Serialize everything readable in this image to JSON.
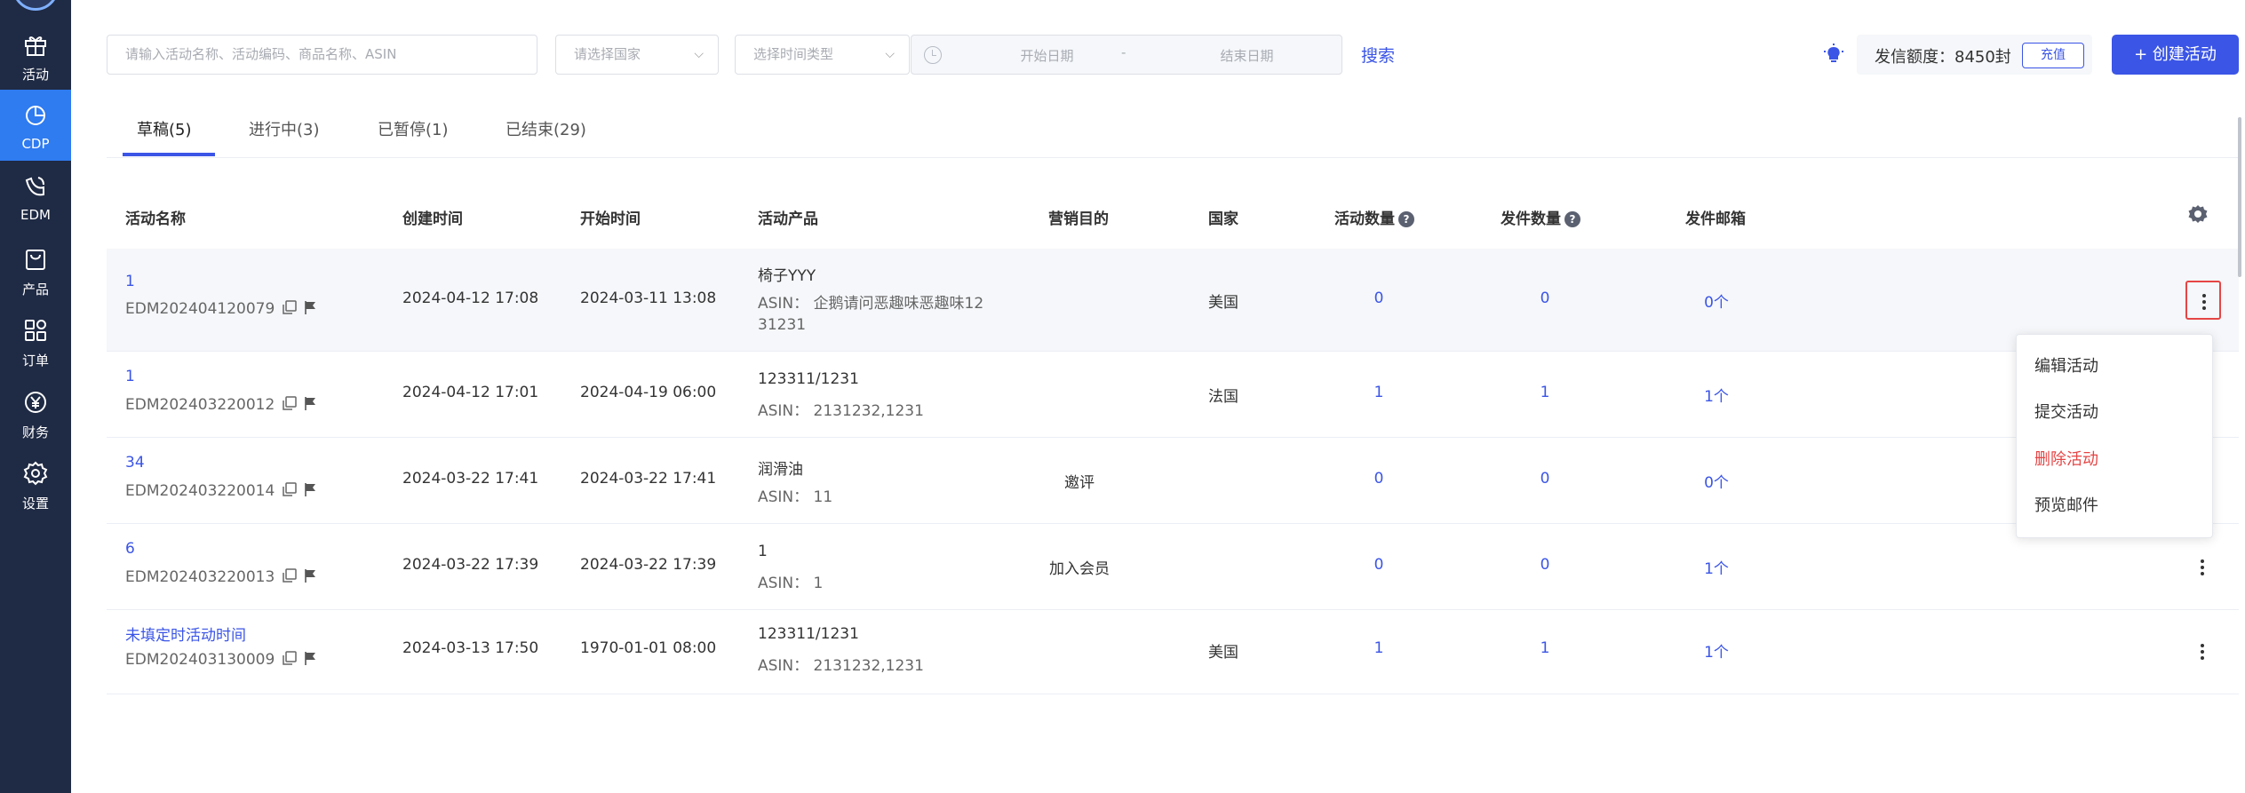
{
  "sidebar": {
    "items": [
      {
        "label": "活动",
        "icon": "gift-icon",
        "active": false
      },
      {
        "label": "CDP",
        "icon": "pie-chart-icon",
        "active": true
      },
      {
        "label": "EDM",
        "icon": "edm-icon",
        "active": false
      },
      {
        "label": "产品",
        "icon": "product-bag-icon",
        "active": false
      },
      {
        "label": "订单",
        "icon": "order-grid-icon",
        "active": false
      },
      {
        "label": "财务",
        "icon": "finance-yen-icon",
        "active": false
      },
      {
        "label": "设置",
        "icon": "settings-gear-icon",
        "active": false
      }
    ]
  },
  "toolbar": {
    "search_placeholder": "请输入活动名称、活动编码、商品名称、ASIN",
    "country_placeholder": "请选择国家",
    "time_type_placeholder": "选择时间类型",
    "start_date_placeholder": "开始日期",
    "date_separator": "-",
    "end_date_placeholder": "结束日期",
    "search_label": "搜索",
    "quota_text": "发信额度：8450封",
    "recharge_label": "充值",
    "create_label": "+ 创建活动"
  },
  "tabs": [
    {
      "label": "草稿(5)",
      "active": true
    },
    {
      "label": "进行中(3)",
      "active": false
    },
    {
      "label": "已暂停(1)",
      "active": false
    },
    {
      "label": "已结束(29)",
      "active": false
    }
  ],
  "table": {
    "headers": {
      "name": "活动名称",
      "created": "创建时间",
      "start": "开始时间",
      "product": "活动产品",
      "purpose": "营销目的",
      "country": "国家",
      "activity_count": "活动数量",
      "send_count": "发件数量",
      "mailbox": "发件邮箱"
    },
    "rows": [
      {
        "name": "1",
        "code": "EDM202404120079",
        "created": "2024-04-12 17:08",
        "start": "2024-03-11 13:08",
        "product": "椅子YYY",
        "asin_line1": "ASIN：  企鹅请问恶趣味恶趣味12",
        "asin_line2": "31231",
        "purpose": "",
        "country": "美国",
        "activity_count": "0",
        "send_count": "0",
        "mailbox": "0个"
      },
      {
        "name": "1",
        "code": "EDM202403220012",
        "created": "2024-04-12 17:01",
        "start": "2024-04-19 06:00",
        "product": "123311/1231",
        "asin_line1": "ASIN：  2131232,1231",
        "asin_line2": "",
        "purpose": "",
        "country": "法国",
        "activity_count": "1",
        "send_count": "1",
        "mailbox": "1个"
      },
      {
        "name": "34",
        "code": "EDM202403220014",
        "created": "2024-03-22 17:41",
        "start": "2024-03-22 17:41",
        "product": "润滑油",
        "asin_line1": "ASIN：  11",
        "asin_line2": "",
        "purpose": "邀评",
        "country": "",
        "activity_count": "0",
        "send_count": "0",
        "mailbox": "0个"
      },
      {
        "name": "6",
        "code": "EDM202403220013",
        "created": "2024-03-22 17:39",
        "start": "2024-03-22 17:39",
        "product": "1",
        "asin_line1": "ASIN：  1",
        "asin_line2": "",
        "purpose": "加入会员",
        "country": "",
        "activity_count": "0",
        "send_count": "0",
        "mailbox": "1个"
      },
      {
        "name": "未填定时活动时间",
        "code": "EDM202403130009",
        "created": "2024-03-13 17:50",
        "start": "1970-01-01 08:00",
        "product": "123311/1231",
        "asin_line1": "ASIN：  2131232,1231",
        "asin_line2": "",
        "purpose": "",
        "country": "美国",
        "activity_count": "1",
        "send_count": "1",
        "mailbox": "1个"
      }
    ]
  },
  "menu": {
    "items": [
      {
        "label": "编辑活动",
        "danger": false
      },
      {
        "label": "提交活动",
        "danger": false
      },
      {
        "label": "删除活动",
        "danger": true
      },
      {
        "label": "预览邮件",
        "danger": false
      }
    ]
  },
  "colors": {
    "sidebar_bg": "#1f2a44",
    "sidebar_active": "#2f7bf0",
    "accent": "#3b55e6",
    "danger": "#e54545"
  }
}
